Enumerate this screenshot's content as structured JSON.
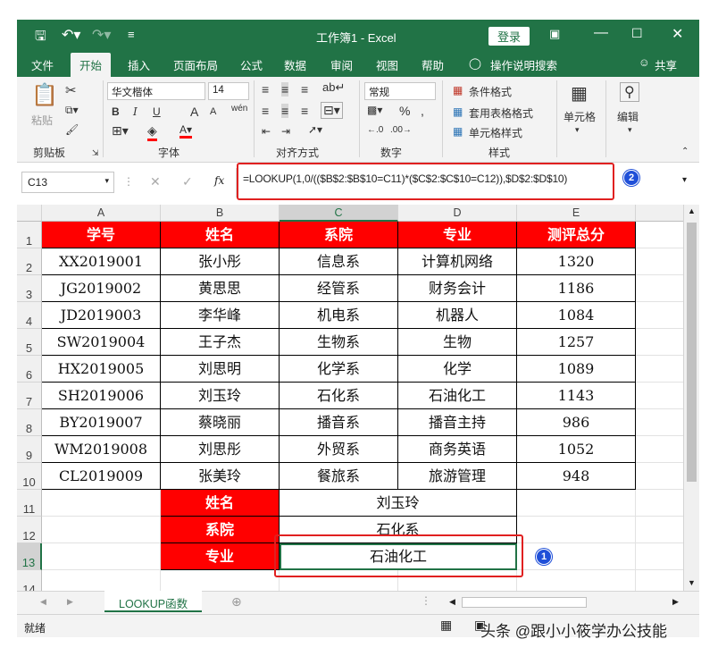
{
  "window": {
    "title": "工作簿1 - Excel",
    "login_label": "登录"
  },
  "tabs": [
    "文件",
    "开始",
    "插入",
    "页面布局",
    "公式",
    "数据",
    "审阅",
    "视图",
    "帮助"
  ],
  "active_tab": "开始",
  "tell_me": "操作说明搜索",
  "share_label": "共享",
  "ribbon": {
    "clipboard": {
      "paste": "粘贴",
      "label": "剪贴板"
    },
    "font": {
      "name": "华文楷体",
      "size": "14",
      "label": "字体",
      "bold": "B",
      "italic": "I",
      "underline": "U",
      "grow": "A",
      "shrink": "A",
      "phonetic": "wén"
    },
    "alignment": {
      "label": "对齐方式"
    },
    "number": {
      "format": "常规",
      "label": "数字",
      "percent": "%"
    },
    "styles": {
      "conditional": "条件格式",
      "table": "套用表格格式",
      "cell": "单元格样式",
      "label": "样式"
    },
    "cells": {
      "label": "单元格"
    },
    "editing": {
      "label": "编辑"
    }
  },
  "formula_bar": {
    "name_box": "C13",
    "fx": "fx",
    "formula": "=LOOKUP(1,0/(($B$2:$B$10=C11)*($C$2:$C$10=C12)),$D$2:$D$10)"
  },
  "annotations": [
    "1",
    "2"
  ],
  "columns": [
    "A",
    "B",
    "C",
    "D",
    "E"
  ],
  "rows": [
    "1",
    "2",
    "3",
    "4",
    "5",
    "6",
    "7",
    "8",
    "9",
    "10",
    "11",
    "12",
    "13",
    "14"
  ],
  "table": {
    "headers": [
      "学号",
      "姓名",
      "系院",
      "专业",
      "测评总分"
    ],
    "rows": [
      [
        "XX2019001",
        "张小彤",
        "信息系",
        "计算机网络",
        "1320"
      ],
      [
        "JG2019002",
        "黄思思",
        "经管系",
        "财务会计",
        "1186"
      ],
      [
        "JD2019003",
        "李华峰",
        "机电系",
        "机器人",
        "1084"
      ],
      [
        "SW2019004",
        "王子杰",
        "生物系",
        "生物",
        "1257"
      ],
      [
        "HX2019005",
        "刘思明",
        "化学系",
        "化学",
        "1089"
      ],
      [
        "SH2019006",
        "刘玉玲",
        "石化系",
        "石油化工",
        "1143"
      ],
      [
        "BY2019007",
        "蔡晓丽",
        "播音系",
        "播音主持",
        "986"
      ],
      [
        "WM2019008",
        "刘思彤",
        "外贸系",
        "商务英语",
        "1052"
      ],
      [
        "CL2019009",
        "张美玲",
        "餐旅系",
        "旅游管理",
        "948"
      ]
    ]
  },
  "lookup": {
    "labels": [
      "姓名",
      "系院",
      "专业"
    ],
    "values": [
      "刘玉玲",
      "石化系",
      "石油化工"
    ]
  },
  "sheet_tab": "LOOKUP函数",
  "status": "就绪",
  "watermark": "头条 @跟小小筱学办公技能",
  "colors": {
    "excel_green": "#217346",
    "header_red": "#ff0000",
    "annotation_red": "#e02020",
    "badge_blue": "#1f4fd8"
  }
}
